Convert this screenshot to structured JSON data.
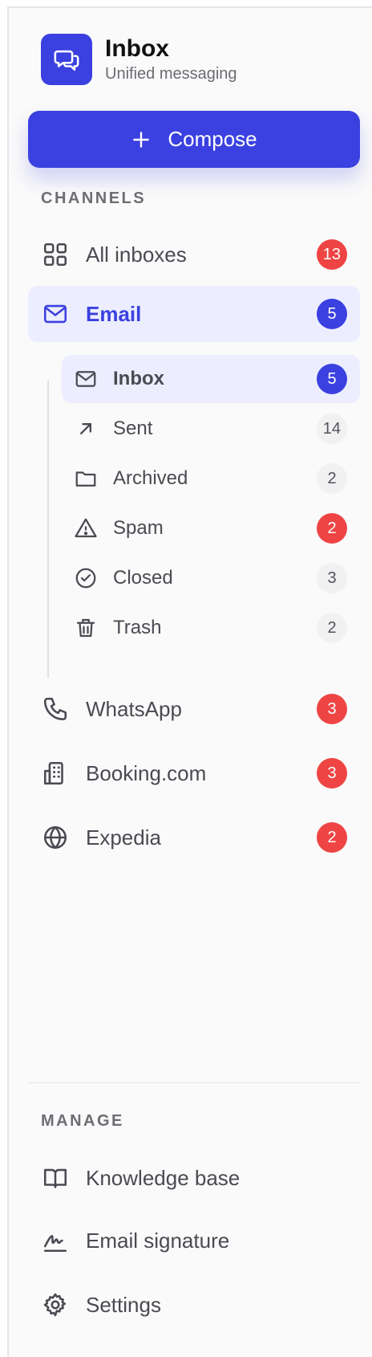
{
  "brand": {
    "title": "Inbox",
    "subtitle": "Unified messaging",
    "icon": "chat-bubbles-icon"
  },
  "compose": {
    "label": "Compose",
    "icon": "plus-icon"
  },
  "channels": {
    "title": "CHANNELS",
    "items": [
      {
        "label": "All inboxes",
        "count": "13",
        "badge": "red",
        "icon": "grid-icon"
      },
      {
        "label": "Email",
        "count": "5",
        "badge": "blue",
        "icon": "mail-icon",
        "active": true
      },
      {
        "label": "WhatsApp",
        "count": "3",
        "badge": "red",
        "icon": "phone-icon"
      },
      {
        "label": "Booking.com",
        "count": "3",
        "badge": "red",
        "icon": "building-icon"
      },
      {
        "label": "Expedia",
        "count": "2",
        "badge": "red",
        "icon": "globe-icon"
      }
    ]
  },
  "email_folders": [
    {
      "label": "Inbox",
      "count": "5",
      "badge": "blue",
      "icon": "mail-icon",
      "active": true
    },
    {
      "label": "Sent",
      "count": "14",
      "badge": "gray",
      "icon": "arrow-up-right-icon"
    },
    {
      "label": "Archived",
      "count": "2",
      "badge": "gray",
      "icon": "folder-icon"
    },
    {
      "label": "Spam",
      "count": "2",
      "badge": "red",
      "icon": "warning-icon"
    },
    {
      "label": "Closed",
      "count": "3",
      "badge": "gray",
      "icon": "check-circle-icon"
    },
    {
      "label": "Trash",
      "count": "2",
      "badge": "gray",
      "icon": "trash-icon"
    }
  ],
  "manage": {
    "title": "MANAGE",
    "items": [
      {
        "label": "Knowledge base",
        "icon": "book-icon"
      },
      {
        "label": "Email signature",
        "icon": "signature-icon"
      },
      {
        "label": "Settings",
        "icon": "gear-icon"
      }
    ]
  },
  "colors": {
    "accent": "#3b40e0",
    "danger": "#ef4444",
    "active_bg": "#eceeff",
    "gray_badge": "#f1f1f2"
  }
}
